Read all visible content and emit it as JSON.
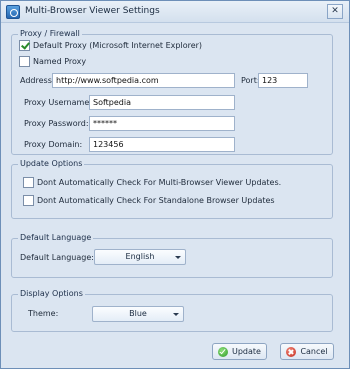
{
  "window": {
    "title": "Multi-Browser Viewer Settings",
    "close_glyph": "✕"
  },
  "proxy": {
    "legend": "Proxy / Firewall",
    "default_proxy_label": "Default Proxy (Microsoft Internet Explorer)",
    "default_proxy_checked": true,
    "named_proxy_label": "Named Proxy",
    "named_proxy_checked": false,
    "address_label": "Address:",
    "address_value": "http://www.softpedia.com",
    "port_label": "Port:",
    "port_value": "123",
    "username_label": "Proxy Username:",
    "username_value": "Softpedia",
    "password_label": "Proxy Password:",
    "password_value": "******",
    "domain_label": "Proxy Domain:",
    "domain_value": "123456"
  },
  "updates": {
    "legend": "Update Options",
    "option1_label": "Dont Automatically Check For Multi-Browser Viewer Updates.",
    "option1_checked": false,
    "option2_label": "Dont Automatically Check For Standalone Browser Updates",
    "option2_checked": false
  },
  "language": {
    "legend": "Default Language",
    "label": "Default Language:",
    "selected": "English"
  },
  "display": {
    "legend": "Display Options",
    "theme_label": "Theme:",
    "theme_selected": "Blue"
  },
  "buttons": {
    "update_label": "Update",
    "cancel_label": "Cancel"
  },
  "icons": {
    "app": "app-icon",
    "update": "check-icon",
    "cancel": "cancel-icon",
    "dropdown": "chevron-down-icon"
  }
}
